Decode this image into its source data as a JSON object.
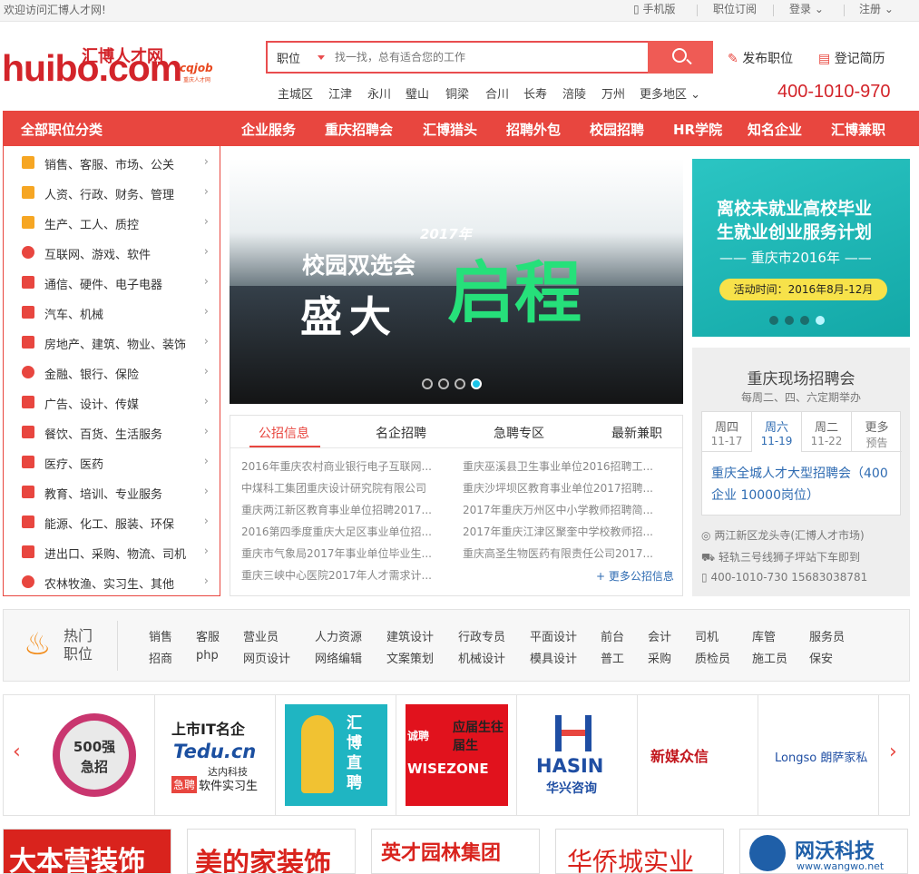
{
  "topbar": {
    "welcome": "欢迎访问汇博人才网!",
    "mobile": "手机版",
    "subscribe": "职位订阅",
    "login": "登录",
    "register": "注册"
  },
  "logo": {
    "main": "huibo.com",
    "cn": "汇博人才网",
    "cqjob": "cqjob",
    "cqjob_sub": "重庆人才网"
  },
  "search": {
    "type": "职位",
    "placeholder": "找一找，总有适合您的工作"
  },
  "header": {
    "post_job": "发布职位",
    "register_resume": "登记简历",
    "phone": "400-1010-970"
  },
  "areas": [
    "主城区",
    "江津",
    "永川",
    "璧山",
    "铜梁",
    "合川",
    "长寿",
    "涪陵",
    "万州",
    "更多地区"
  ],
  "nav": {
    "all": "全部职位分类",
    "items": [
      "企业服务",
      "重庆招聘会",
      "汇博猎头",
      "招聘外包",
      "校园招聘",
      "HR学院",
      "知名企业",
      "汇博兼职"
    ]
  },
  "categories": [
    "销售、客服、市场、公关",
    "人资、行政、财务、管理",
    "生产、工人、质控",
    "互联网、游戏、软件",
    "通信、硬件、电子电器",
    "汽车、机械",
    "房地产、建筑、物业、装饰",
    "金融、银行、保险",
    "广告、设计、传媒",
    "餐饮、百货、生活服务",
    "医疗、医药",
    "教育、培训、专业服务",
    "能源、化工、服装、环保",
    "进出口、采购、物流、司机",
    "农林牧渔、实习生、其他"
  ],
  "banner": {
    "year": "2017年",
    "line1": "校园双选会",
    "line2": "盛大",
    "line3": "启程"
  },
  "side_ad": {
    "line1": "离校未就业高校毕业",
    "line2": "生就业创业服务计划",
    "line3": "重庆市2016年",
    "time": "活动时间：2016年8月-12月"
  },
  "news": {
    "tabs": [
      "公招信息",
      "名企招聘",
      "急聘专区",
      "最新兼职"
    ],
    "left": [
      "2016年重庆农村商业银行电子互联网...",
      "中煤科工集团重庆设计研究院有限公司",
      "重庆两江新区教育事业单位招聘2017...",
      "2016第四季度重庆大足区事业单位招...",
      "重庆市气象局2017年事业单位毕业生...",
      "重庆三峡中心医院2017年人才需求计..."
    ],
    "right": [
      "重庆巫溪县卫生事业单位2016招聘工...",
      "重庆沙坪坝区教育事业单位2017招聘...",
      "2017年重庆万州区中小学教师招聘简...",
      "2017年重庆江津区聚奎中学校教师招...",
      "重庆高圣生物医药有限责任公司2017..."
    ],
    "more": "+ 更多公招信息"
  },
  "fair": {
    "title": "重庆现场招聘会",
    "sub": "每周二、四、六定期举办",
    "days": [
      {
        "name": "周四",
        "date": "11-17"
      },
      {
        "name": "周六",
        "date": "11-19"
      },
      {
        "name": "周二",
        "date": "11-22"
      },
      {
        "name": "更多",
        "date": "预告"
      }
    ],
    "desc": "重庆全城人才大型招聘会（400企业 10000岗位）",
    "address": "两江新区龙头寺(汇博人才市场)",
    "traffic": "轻轨三号线狮子坪站下车即到",
    "tel": "400-1010-730 15683038781"
  },
  "hot": {
    "label1": "热门",
    "label2": "职位",
    "row1": [
      "销售",
      "客服",
      "营业员",
      "人力资源",
      "建筑设计",
      "行政专员",
      "平面设计",
      "前台",
      "会计",
      "司机",
      "库管",
      "服务员"
    ],
    "row2": [
      "招商",
      "php",
      "网页设计",
      "网络编辑",
      "文案策划",
      "机械设计",
      "模具设计",
      "普工",
      "采购",
      "质检员",
      "施工员",
      "保安"
    ]
  },
  "companies": {
    "c1": "500强 急招",
    "c2a": "上市IT名企",
    "c2b": "Tedu.cn",
    "c2c": "达内科技",
    "c2d": "急聘",
    "c2e": "软件实习生",
    "c3": "汇博直聘",
    "c4a": "诚聘",
    "c4b": "应届生往届生",
    "c4c": "WISEZONE",
    "c5a": "HASIN",
    "c5b": "华兴咨询",
    "c6": "新媒众信",
    "c7": "Longso 朗萨家私"
  },
  "ads": [
    "大本营装饰",
    "美的家装饰",
    "英才园林集团",
    "华侨城实业",
    "网沃科技",
    "www.wangwo.net"
  ]
}
